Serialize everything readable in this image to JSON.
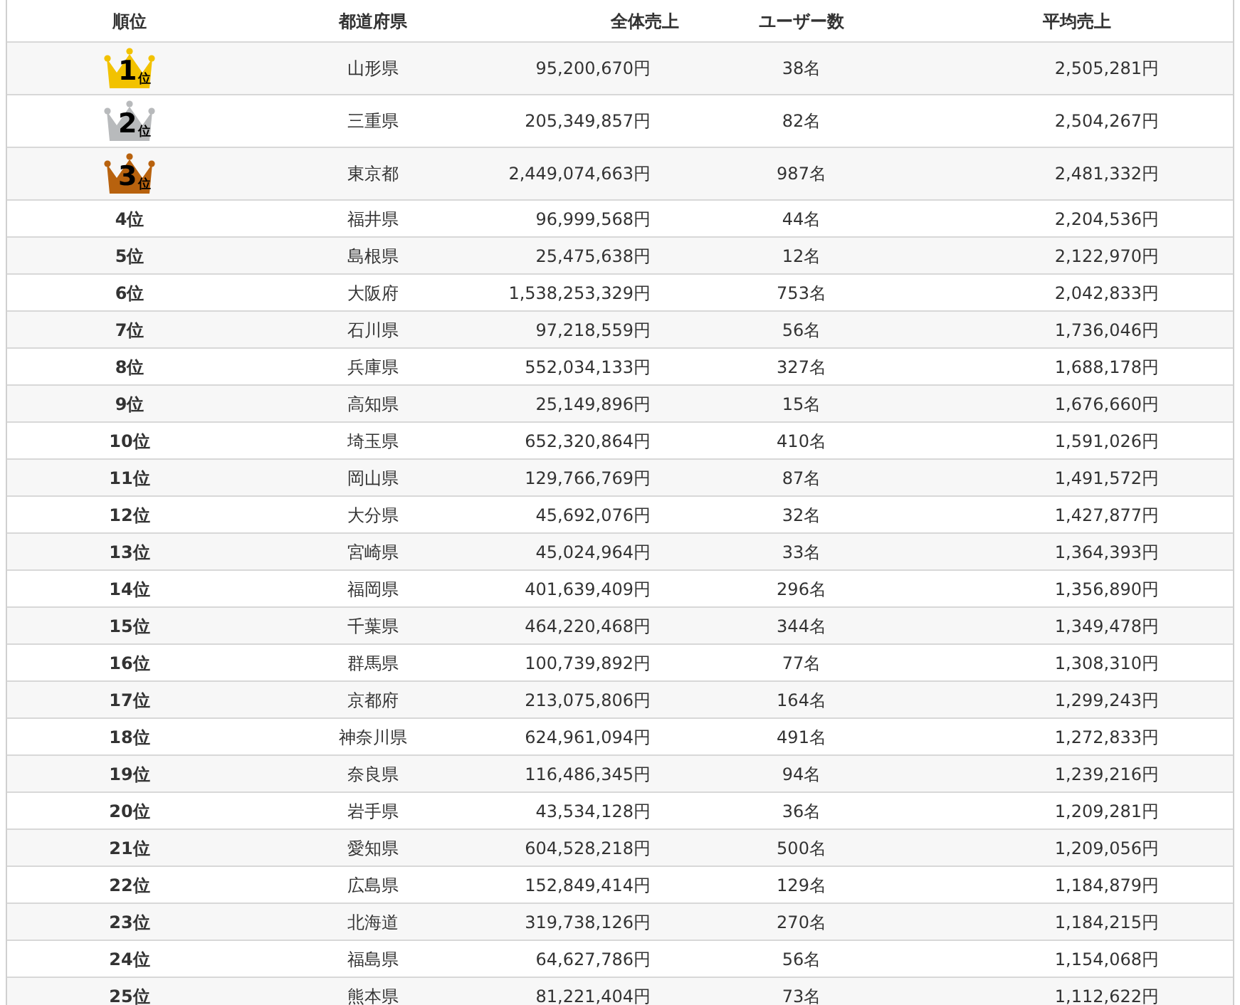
{
  "table": {
    "columns": [
      "順位",
      "都道府県",
      "全体売上",
      "ユーザー数",
      "平均売上"
    ],
    "rows": [
      {
        "kind": "crown",
        "color": "#f2c200",
        "rank": "1",
        "rank_suffix": "位",
        "prefecture": "山形県",
        "total_sales": "95,200,670円",
        "users": "38名",
        "average_sales": "2,505,281円"
      },
      {
        "kind": "crown",
        "color": "#b8babc",
        "rank": "2",
        "rank_suffix": "位",
        "prefecture": "三重県",
        "total_sales": "205,349,857円",
        "users": "82名",
        "average_sales": "2,504,267円"
      },
      {
        "kind": "crown",
        "color": "#b8620e",
        "rank": "3",
        "rank_suffix": "位",
        "prefecture": "東京都",
        "total_sales": "2,449,074,663円",
        "users": "987名",
        "average_sales": "2,481,332円"
      },
      {
        "kind": "plain",
        "rank": "4位",
        "prefecture": "福井県",
        "total_sales": "96,999,568円",
        "users": "44名",
        "average_sales": "2,204,536円"
      },
      {
        "kind": "plain",
        "rank": "5位",
        "prefecture": "島根県",
        "total_sales": "25,475,638円",
        "users": "12名",
        "average_sales": "2,122,970円"
      },
      {
        "kind": "plain",
        "rank": "6位",
        "prefecture": "大阪府",
        "total_sales": "1,538,253,329円",
        "users": "753名",
        "average_sales": "2,042,833円"
      },
      {
        "kind": "plain",
        "rank": "7位",
        "prefecture": "石川県",
        "total_sales": "97,218,559円",
        "users": "56名",
        "average_sales": "1,736,046円"
      },
      {
        "kind": "plain",
        "rank": "8位",
        "prefecture": "兵庫県",
        "total_sales": "552,034,133円",
        "users": "327名",
        "average_sales": "1,688,178円"
      },
      {
        "kind": "plain",
        "rank": "9位",
        "prefecture": "高知県",
        "total_sales": "25,149,896円",
        "users": "15名",
        "average_sales": "1,676,660円"
      },
      {
        "kind": "plain",
        "rank": "10位",
        "prefecture": "埼玉県",
        "total_sales": "652,320,864円",
        "users": "410名",
        "average_sales": "1,591,026円"
      },
      {
        "kind": "plain",
        "rank": "11位",
        "prefecture": "岡山県",
        "total_sales": "129,766,769円",
        "users": "87名",
        "average_sales": "1,491,572円"
      },
      {
        "kind": "plain",
        "rank": "12位",
        "prefecture": "大分県",
        "total_sales": "45,692,076円",
        "users": "32名",
        "average_sales": "1,427,877円"
      },
      {
        "kind": "plain",
        "rank": "13位",
        "prefecture": "宮崎県",
        "total_sales": "45,024,964円",
        "users": "33名",
        "average_sales": "1,364,393円"
      },
      {
        "kind": "plain",
        "rank": "14位",
        "prefecture": "福岡県",
        "total_sales": "401,639,409円",
        "users": "296名",
        "average_sales": "1,356,890円"
      },
      {
        "kind": "plain",
        "rank": "15位",
        "prefecture": "千葉県",
        "total_sales": "464,220,468円",
        "users": "344名",
        "average_sales": "1,349,478円"
      },
      {
        "kind": "plain",
        "rank": "16位",
        "prefecture": "群馬県",
        "total_sales": "100,739,892円",
        "users": "77名",
        "average_sales": "1,308,310円"
      },
      {
        "kind": "plain",
        "rank": "17位",
        "prefecture": "京都府",
        "total_sales": "213,075,806円",
        "users": "164名",
        "average_sales": "1,299,243円"
      },
      {
        "kind": "plain",
        "rank": "18位",
        "prefecture": "神奈川県",
        "total_sales": "624,961,094円",
        "users": "491名",
        "average_sales": "1,272,833円"
      },
      {
        "kind": "plain",
        "rank": "19位",
        "prefecture": "奈良県",
        "total_sales": "116,486,345円",
        "users": "94名",
        "average_sales": "1,239,216円"
      },
      {
        "kind": "plain",
        "rank": "20位",
        "prefecture": "岩手県",
        "total_sales": "43,534,128円",
        "users": "36名",
        "average_sales": "1,209,281円"
      },
      {
        "kind": "plain",
        "rank": "21位",
        "prefecture": "愛知県",
        "total_sales": "604,528,218円",
        "users": "500名",
        "average_sales": "1,209,056円"
      },
      {
        "kind": "plain",
        "rank": "22位",
        "prefecture": "広島県",
        "total_sales": "152,849,414円",
        "users": "129名",
        "average_sales": "1,184,879円"
      },
      {
        "kind": "plain",
        "rank": "23位",
        "prefecture": "北海道",
        "total_sales": "319,738,126円",
        "users": "270名",
        "average_sales": "1,184,215円"
      },
      {
        "kind": "plain",
        "rank": "24位",
        "prefecture": "福島県",
        "total_sales": "64,627,786円",
        "users": "56名",
        "average_sales": "1,154,068円"
      },
      {
        "kind": "plain",
        "rank": "25位",
        "prefecture": "熊本県",
        "total_sales": "81,221,404円",
        "users": "73名",
        "average_sales": "1,112,622円"
      }
    ]
  }
}
